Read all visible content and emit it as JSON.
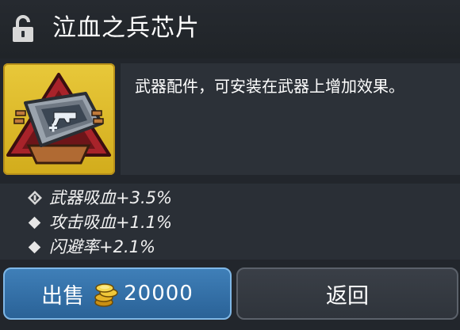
{
  "header": {
    "title": "泣血之兵芯片",
    "lock_icon": "unlocked-padlock-icon"
  },
  "item": {
    "icon": "weapon-chip-icon",
    "frame_color": "#e3c12f",
    "description": "武器配件，可安装在武器上增加效果。"
  },
  "stats": [
    {
      "icon": "rank-badge-icon",
      "text": "武器吸血+3.5%"
    },
    {
      "icon": "diamond-bullet-icon",
      "text": "攻击吸血+1.1%"
    },
    {
      "icon": "diamond-bullet-icon",
      "text": "闪避率+2.1%"
    }
  ],
  "buttons": {
    "sell_label": "出售",
    "sell_price": "20000",
    "coin_icon": "gold-coin-stack-icon",
    "back_label": "返回"
  },
  "colors": {
    "sell_button": "#3570a8",
    "back_button": "#353a42",
    "panel_bg": "#22262c"
  }
}
